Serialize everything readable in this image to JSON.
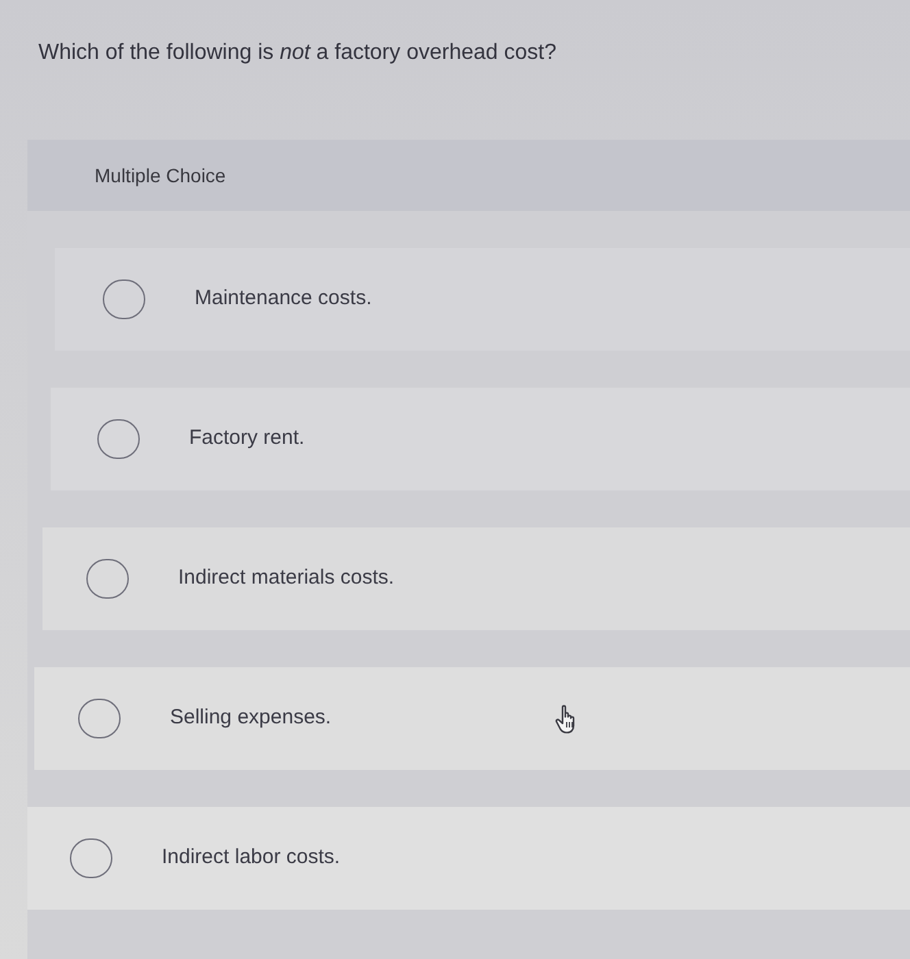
{
  "question": {
    "text": "Which of the following is *not* a factory overhead cost?"
  },
  "answer_panel": {
    "header": "Multiple Choice",
    "options": [
      {
        "label": "Maintenance costs.",
        "selected": false
      },
      {
        "label": "Factory rent.",
        "selected": false
      },
      {
        "label": "Indirect materials costs.",
        "selected": false
      },
      {
        "label": "Selling expenses.",
        "selected": false
      },
      {
        "label": "Indirect labor costs.",
        "selected": false
      }
    ]
  }
}
